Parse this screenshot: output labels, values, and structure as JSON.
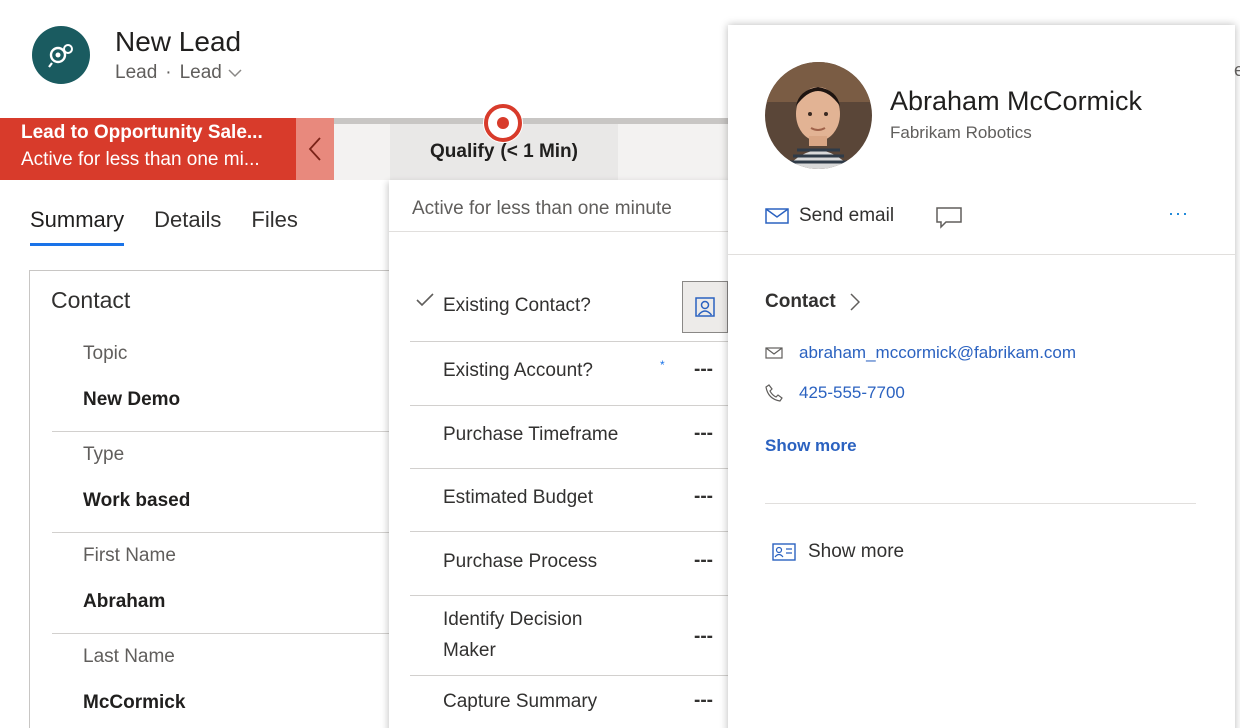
{
  "header": {
    "title": "New Lead",
    "entity": "Lead",
    "separator": "·",
    "form": "Lead",
    "avatar_color": "#1a5b60"
  },
  "process": {
    "name": "Lead to Opportunity Sale...",
    "duration": "Active for less than one mi...",
    "stage_label": "Qualify",
    "stage_time": "(< 1 Min)",
    "active_color": "#d83b2b"
  },
  "tabs": [
    "Summary",
    "Details",
    "Files"
  ],
  "contact_section": {
    "title": "Contact",
    "fields": [
      {
        "label": "Topic",
        "value": "New Demo"
      },
      {
        "label": "Type",
        "value": "Work based"
      },
      {
        "label": "First Name",
        "value": "Abraham"
      },
      {
        "label": "Last Name",
        "value": "McCormick"
      }
    ]
  },
  "stage_flyout": {
    "active_time": "Active for less than one minute",
    "steps": [
      {
        "name": "Existing Contact?",
        "value": ""
      },
      {
        "name": "Existing Account?",
        "value": "---"
      },
      {
        "name": "Purchase Timeframe",
        "value": "---"
      },
      {
        "name": "Estimated Budget",
        "value": "---"
      },
      {
        "name": "Purchase Process",
        "value": "---"
      },
      {
        "name": "Identify Decision Maker",
        "value": "---"
      },
      {
        "name": "Capture Summary",
        "value": "---"
      }
    ],
    "required_marker": "*"
  },
  "contact_card": {
    "name": "Abraham McCormick",
    "company": "Fabrikam Robotics",
    "send_email": "Send email",
    "more": "···",
    "section_title": "Contact",
    "email": "abraham_mccormick@fabrikam.com",
    "phone": "425-555-7700",
    "show_more": "Show more",
    "show_more_2": "Show more",
    "link_color": "#2b62c0"
  },
  "edge_fragment": "e"
}
